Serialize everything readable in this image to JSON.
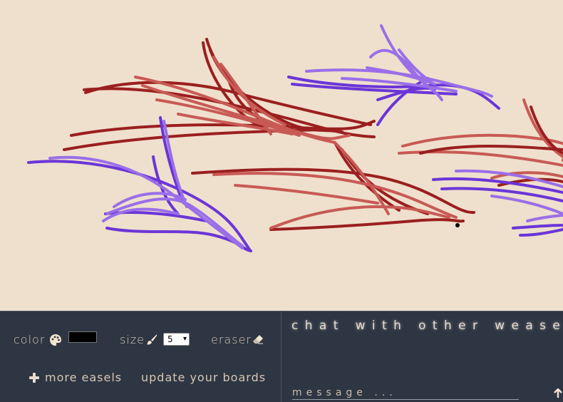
{
  "canvas": {
    "background": "#efe0cd",
    "stroke_colors": {
      "dark_red": "#9b1f1f",
      "coral": "#c85a55",
      "purple": "#6b35d8",
      "lavender": "#9b6ee8"
    }
  },
  "toolbar": {
    "color_label": "color",
    "palette_icon": "palette-icon",
    "selected_color": "#000000",
    "size_label": "size",
    "brush_icon": "brush-icon",
    "size_value": "5",
    "eraser_label": "eraser",
    "eraser_icon": "eraser-icon",
    "more_easels_label": "more easels",
    "update_boards_label": "update your boards"
  },
  "chat": {
    "title": "chat with other weasels",
    "message_placeholder": "message ...",
    "send_icon": "arrow-up-icon"
  }
}
